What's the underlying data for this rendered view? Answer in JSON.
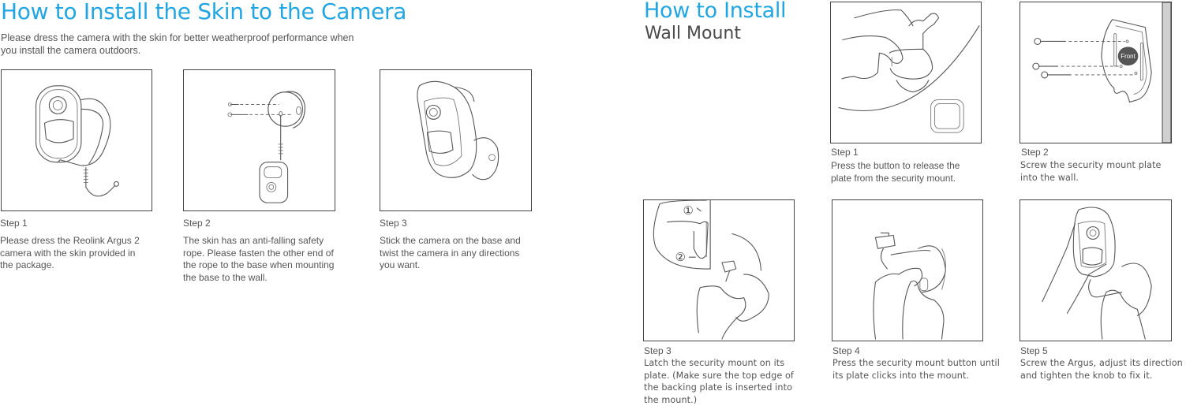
{
  "left_section": {
    "title": "How to Install the Skin to the Camera",
    "intro": "Please dress the camera with the skin for better weatherproof performance when you install the camera outdoors.",
    "steps": [
      {
        "label": "Step 1",
        "text": "Please dress the Reolink Argus 2 camera with the skin provided in the package.",
        "illustration": "camera-with-skin-illustration"
      },
      {
        "label": "Step 2",
        "text": "The skin has an anti-falling safety rope. Please fasten the other end of the rope to the base when mounting the base to the wall.",
        "illustration": "safety-rope-base-illustration"
      },
      {
        "label": "Step 3",
        "text": "Stick the camera on the base and twist the camera in any directions you want.",
        "illustration": "camera-on-base-illustration"
      }
    ]
  },
  "right_section": {
    "title_line1": "How to Install",
    "title_line2": "Wall Mount",
    "steps": [
      {
        "label": "Step 1",
        "text": "Press the button to release the plate from the security mount.",
        "illustration": "release-plate-illustration"
      },
      {
        "label": "Step 2",
        "text": "Screw the security mount plate into the wall.",
        "illustration": "screw-plate-illustration",
        "badge": "Front"
      },
      {
        "label": "Step 3",
        "text": "Latch the security mount on its plate. (Make sure the top edge of the backing plate is inserted into the mount.)",
        "illustration": "latch-mount-illustration",
        "markers": [
          "①",
          "②"
        ]
      },
      {
        "label": "Step 4",
        "text": "Press the security mount button until its plate clicks into the mount.",
        "illustration": "press-button-illustration"
      },
      {
        "label": "Step 5",
        "text": "Screw the Argus, adjust its direction and tighten the knob to fix it.",
        "illustration": "screw-argus-illustration"
      }
    ]
  },
  "colors": {
    "title_blue": "#22a6e2",
    "text_gray": "#555555",
    "border": "#444444"
  }
}
